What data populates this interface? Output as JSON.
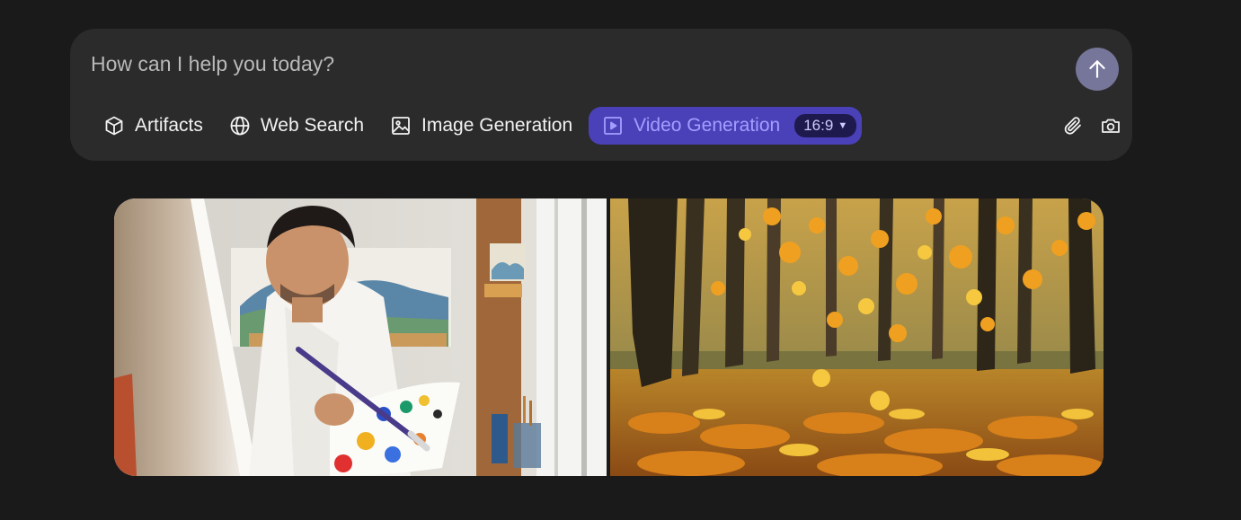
{
  "composer": {
    "placeholder": "How can I help you today?",
    "send_icon": "arrow-up-icon"
  },
  "tools": [
    {
      "label": "Artifacts",
      "icon": "cube-icon"
    },
    {
      "label": "Web Search",
      "icon": "globe-icon"
    },
    {
      "label": "Image Generation",
      "icon": "image-icon"
    },
    {
      "label": "Video Generation",
      "icon": "play-square-icon",
      "active": true
    }
  ],
  "aspect_ratio": {
    "value": "16:9",
    "icon": "caret-down-icon"
  },
  "right_actions": [
    {
      "icon": "paperclip-icon"
    },
    {
      "icon": "camera-icon"
    }
  ],
  "gallery": [
    {
      "subject": "artist-painting-in-studio"
    },
    {
      "subject": "autumn-leaves-in-forest"
    }
  ],
  "colors": {
    "background": "#1a1a1a",
    "composer": "#2b2b2b",
    "accent": "#4a41b8",
    "accent_text": "#a49dff",
    "send_button": "#76769a"
  }
}
